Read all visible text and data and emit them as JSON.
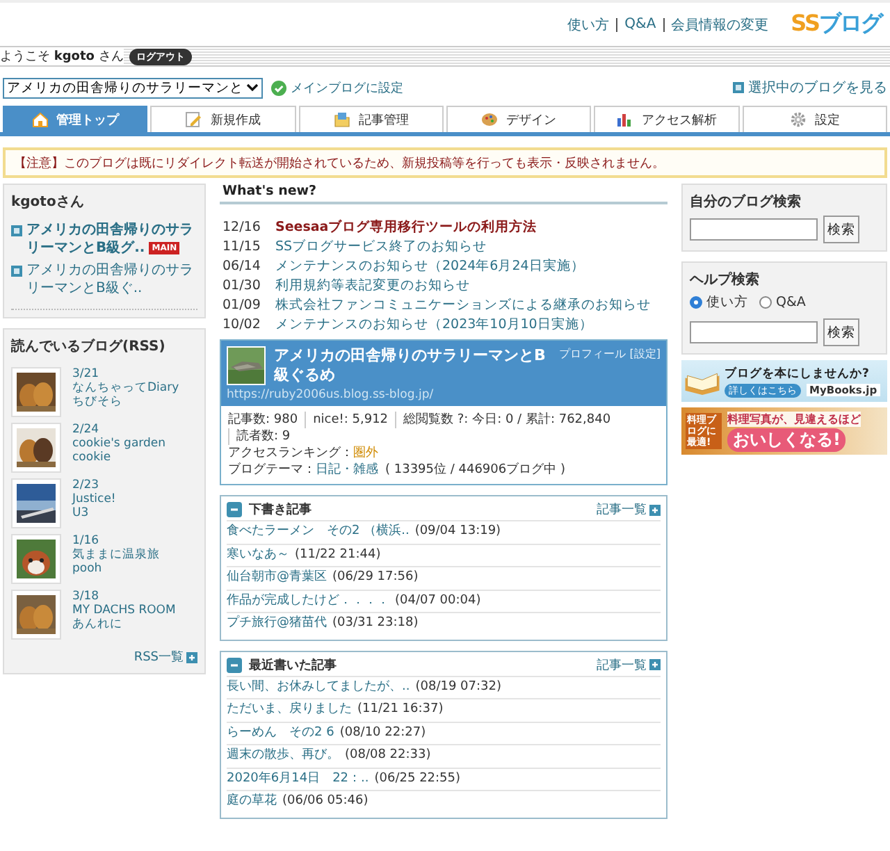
{
  "header": {
    "links": [
      "使い方",
      "Q&A",
      "会員情報の変更"
    ],
    "logo": [
      "SS",
      "ブログ"
    ]
  },
  "welcome": {
    "text": "ようこそ **kgoto** さん",
    "logout": "ログアウト"
  },
  "blog_select": {
    "value": "アメリカの田舎帰りのサラリーマンと",
    "set_main": "メインブログに設定",
    "view_blog": "選択中のブログを見る"
  },
  "tabs": [
    {
      "label": "管理トップ",
      "selected": true
    },
    {
      "label": "新規作成",
      "selected": false
    },
    {
      "label": "記事管理",
      "selected": false
    },
    {
      "label": "デザイン",
      "selected": false
    },
    {
      "label": "アクセス解析",
      "selected": false
    },
    {
      "label": "設定",
      "selected": false
    }
  ],
  "notice": "【注意】このブログは既にリダイレクト転送が開始されているため、新規投稿等を行っても表示・反映されません。",
  "account": {
    "title": "kgotoさん",
    "blogs": [
      {
        "title": "アメリカの田舎帰りのサラリーマンとB級グ..",
        "badge": "MAIN",
        "bold": true
      },
      {
        "title": "アメリカの田舎帰りのサラリーマンとB級ぐ..",
        "bold": false
      }
    ]
  },
  "rss": {
    "title": "読んでいるブログ(RSS)",
    "more": "RSS一覧",
    "feeds": [
      {
        "date": "3/21",
        "blog": "なんちゃってDiary",
        "author": "ちびそら"
      },
      {
        "date": "2/24",
        "blog": "cookie's garden",
        "author": "cookie"
      },
      {
        "date": "2/23",
        "blog": "Justice!",
        "author": "U3"
      },
      {
        "date": "1/16",
        "blog": "気ままに温泉旅",
        "author": "pooh"
      },
      {
        "date": "3/18",
        "blog": "MY DACHS ROOM",
        "author": "あんれに"
      }
    ]
  },
  "whats_new": {
    "title": "What's new?",
    "items": [
      {
        "date": "12/16",
        "title": "Seesaaブログ専用移行ツールの利用方法",
        "important": true
      },
      {
        "date": "11/15",
        "title": "SSブログサービス終了のお知らせ",
        "important": false
      },
      {
        "date": "06/14",
        "title": "メンテナンスのお知らせ（2024年6月24日実施）",
        "important": false
      },
      {
        "date": "01/30",
        "title": "利用規約等表記変更のお知らせ",
        "important": false
      },
      {
        "date": "01/09",
        "title": "株式会社ファンコミュニケーションズによる継承のお知らせ",
        "important": false
      },
      {
        "date": "10/02",
        "title": "メンテナンスのお知らせ（2023年10月10日実施）",
        "important": false
      }
    ]
  },
  "blog_card": {
    "title": "アメリカの田舎帰りのサラリーマンとB級ぐるめ",
    "profile": "プロフィール",
    "settings": "[設定]",
    "url": "https://ruby2006us.blog.ss-blog.jp/",
    "stats": [
      "記事数: 980",
      "nice!: 5,912",
      "総閲覧数 ?: 今日: 0 / 累計: 762,840",
      "読者数: 9"
    ],
    "ranking_label": "アクセスランキング：",
    "ranking": "圏外",
    "theme_label": "ブログテーマ：",
    "theme": "日記・雑感",
    "theme_rank": "( 13395位 / 446906ブログ中 )"
  },
  "drafts": {
    "title": "下書き記事",
    "more": "記事一覧",
    "items": [
      {
        "title": "食べたラーメン　その2 （横浜..",
        "time": "(09/04 13:19)"
      },
      {
        "title": "寒いなあ～",
        "time": "(11/22 21:44)"
      },
      {
        "title": "仙台朝市@青葉区",
        "time": "(06/29 17:56)"
      },
      {
        "title": "作品が完成したけど．．．．",
        "time": "(04/07 00:04)"
      },
      {
        "title": "プチ旅行@猪苗代",
        "time": "(03/31 23:18)"
      }
    ]
  },
  "recent": {
    "title": "最近書いた記事",
    "more": "記事一覧",
    "items": [
      {
        "title": "長い間、お休みしてましたが、..",
        "time": "(08/19 07:32)"
      },
      {
        "title": "ただいま、戻りました",
        "time": "(11/21 16:37)"
      },
      {
        "title": "らーめん　その2 6",
        "time": "(08/10 22:27)"
      },
      {
        "title": "週末の散歩、再び。",
        "time": "(08/08 22:33)"
      },
      {
        "title": "2020年6月14日　22：..",
        "time": "(06/25 22:55)"
      },
      {
        "title": "庭の草花",
        "time": "(06/06 05:46)"
      }
    ]
  },
  "my_search": {
    "title": "自分のブログ検索",
    "button": "検索"
  },
  "help_search": {
    "title": "ヘルプ検索",
    "button": "検索",
    "options": [
      {
        "label": "使い方",
        "selected": true
      },
      {
        "label": "Q&A",
        "selected": false
      }
    ]
  },
  "banners": [
    {
      "kind": "book",
      "headline": "ブログを本にしませんか?",
      "button": "詳しくはこちら",
      "brand": "MyBooks.jp"
    },
    {
      "kind": "food",
      "side": "料理ブログに最適!",
      "headline": "料理写真が、見違えるほど",
      "big": "おいしくなる!"
    }
  ]
}
